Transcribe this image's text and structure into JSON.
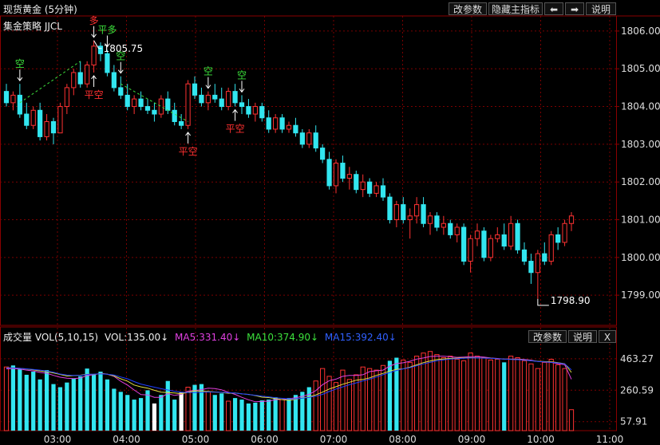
{
  "header": {
    "title": "现货黄金 (5分钟)",
    "strategy": "集金策略 JJCL",
    "buttons": {
      "params": "改参数",
      "hide_indicator": "隐藏主指标",
      "left": "⬅",
      "right": "➡",
      "help": "说明"
    }
  },
  "volume_header": {
    "title": "成交量 VOL(5,10,15)",
    "vol": "VOL:135.00↓",
    "ma5": "MA5:331.40↓",
    "ma10": "MA10:374.90↓",
    "ma15": "MA15:392.40↓",
    "buttons": {
      "params": "改参数",
      "help": "说明",
      "close": "X"
    }
  },
  "colors": {
    "up": "#ff3232",
    "down": "#32e6f0",
    "ma5": "#e040e0",
    "ma10": "#e0e040",
    "ma15": "#2040ff",
    "grid": "#7a0000",
    "axis_text": "#ddd",
    "signal_green": "#3ce03c",
    "signal_red": "#ff3030"
  },
  "chart_data": [
    {
      "type": "candlestick",
      "x_ticks": [
        "03:00",
        "04:00",
        "05:00",
        "06:00",
        "07:00",
        "08:00",
        "09:00",
        "10:00",
        "11:00"
      ],
      "y_ticks": [
        1799,
        1800,
        1801,
        1802,
        1803,
        1804,
        1805,
        1806
      ],
      "y_tick_labels": [
        "1799.00",
        "1800.00",
        "1801.00",
        "1802.00",
        "1803.00",
        "1804.00",
        "1805.00",
        "1806.00"
      ],
      "ylim": [
        1798.2,
        1806.4
      ],
      "annotations": {
        "high": "1805.75",
        "low": "1798.90"
      },
      "signals": [
        {
          "label": "空",
          "arrow": "down",
          "bar": 2
        },
        {
          "label": "多",
          "arrow": "down",
          "bar": 13
        },
        {
          "label": "平多",
          "arrow": "down",
          "bar": 15
        },
        {
          "label": "平空",
          "arrow": "up",
          "bar": 13
        },
        {
          "label": "空",
          "arrow": "down",
          "bar": 17
        },
        {
          "label": "平空",
          "arrow": "up",
          "bar": 27
        },
        {
          "label": "空",
          "arrow": "down",
          "bar": 30
        },
        {
          "label": "空",
          "arrow": "down",
          "bar": 35
        },
        {
          "label": "平空",
          "arrow": "up",
          "bar": 34
        }
      ],
      "ohlc": [
        [
          1804.4,
          1804.6,
          1804.0,
          1804.1
        ],
        [
          1804.1,
          1804.4,
          1803.9,
          1804.3
        ],
        [
          1804.3,
          1804.6,
          1803.7,
          1803.8
        ],
        [
          1803.8,
          1804.1,
          1803.4,
          1803.5
        ],
        [
          1803.5,
          1804.0,
          1803.4,
          1803.9
        ],
        [
          1803.9,
          1804.1,
          1803.1,
          1803.2
        ],
        [
          1803.2,
          1803.8,
          1803.1,
          1803.6
        ],
        [
          1803.6,
          1803.7,
          1803.0,
          1803.3
        ],
        [
          1803.3,
          1804.1,
          1803.3,
          1804.0
        ],
        [
          1804.0,
          1804.6,
          1803.8,
          1804.5
        ],
        [
          1804.5,
          1805.0,
          1804.3,
          1804.9
        ],
        [
          1804.9,
          1805.2,
          1804.5,
          1804.6
        ],
        [
          1804.6,
          1805.2,
          1804.5,
          1805.1
        ],
        [
          1805.1,
          1805.75,
          1804.9,
          1805.6
        ],
        [
          1805.6,
          1805.7,
          1805.2,
          1805.4
        ],
        [
          1805.4,
          1805.5,
          1804.8,
          1804.9
        ],
        [
          1804.9,
          1805.1,
          1804.4,
          1804.5
        ],
        [
          1804.5,
          1804.8,
          1804.2,
          1804.3
        ],
        [
          1804.3,
          1804.6,
          1803.9,
          1804.0
        ],
        [
          1804.0,
          1804.3,
          1803.8,
          1804.2
        ],
        [
          1804.2,
          1804.4,
          1803.9,
          1804.0
        ],
        [
          1804.0,
          1804.2,
          1803.8,
          1803.9
        ],
        [
          1803.9,
          1804.1,
          1803.6,
          1803.8
        ],
        [
          1803.8,
          1804.3,
          1803.7,
          1804.2
        ],
        [
          1804.2,
          1804.4,
          1803.8,
          1803.9
        ],
        [
          1803.9,
          1804.1,
          1803.5,
          1803.6
        ],
        [
          1803.6,
          1803.8,
          1803.4,
          1803.5
        ],
        [
          1803.5,
          1804.7,
          1803.4,
          1804.6
        ],
        [
          1804.6,
          1804.8,
          1804.2,
          1804.3
        ],
        [
          1804.3,
          1804.5,
          1804.0,
          1804.1
        ],
        [
          1804.1,
          1804.4,
          1803.9,
          1804.3
        ],
        [
          1804.3,
          1804.6,
          1804.1,
          1804.2
        ],
        [
          1804.2,
          1804.5,
          1803.9,
          1804.0
        ],
        [
          1804.0,
          1804.5,
          1803.9,
          1804.4
        ],
        [
          1804.4,
          1804.6,
          1804.0,
          1804.1
        ],
        [
          1804.1,
          1804.3,
          1803.8,
          1804.0
        ],
        [
          1804.0,
          1804.2,
          1803.7,
          1803.8
        ],
        [
          1803.8,
          1804.1,
          1803.6,
          1804.0
        ],
        [
          1804.0,
          1804.1,
          1803.6,
          1803.7
        ],
        [
          1803.7,
          1803.9,
          1803.3,
          1803.4
        ],
        [
          1803.4,
          1803.8,
          1803.3,
          1803.7
        ],
        [
          1803.7,
          1803.8,
          1803.3,
          1803.4
        ],
        [
          1803.4,
          1803.6,
          1803.3,
          1803.5
        ],
        [
          1803.5,
          1803.7,
          1803.2,
          1803.3
        ],
        [
          1803.3,
          1803.4,
          1802.9,
          1803.0
        ],
        [
          1803.0,
          1803.4,
          1802.9,
          1803.3
        ],
        [
          1803.3,
          1803.5,
          1802.8,
          1802.9
        ],
        [
          1802.9,
          1803.0,
          1802.5,
          1802.6
        ],
        [
          1802.6,
          1802.8,
          1801.8,
          1801.9
        ],
        [
          1801.9,
          1802.6,
          1801.7,
          1802.5
        ],
        [
          1802.5,
          1802.7,
          1802.0,
          1802.1
        ],
        [
          1802.1,
          1802.4,
          1801.8,
          1802.2
        ],
        [
          1802.2,
          1802.3,
          1801.7,
          1801.8
        ],
        [
          1801.8,
          1802.2,
          1801.6,
          1802.0
        ],
        [
          1802.0,
          1802.1,
          1801.6,
          1801.7
        ],
        [
          1801.7,
          1802.0,
          1801.6,
          1801.9
        ],
        [
          1801.9,
          1802.1,
          1801.5,
          1801.6
        ],
        [
          1801.6,
          1801.7,
          1800.9,
          1801.0
        ],
        [
          1801.0,
          1801.5,
          1800.8,
          1801.4
        ],
        [
          1801.4,
          1801.6,
          1800.9,
          1801.0
        ],
        [
          1801.0,
          1801.3,
          1800.5,
          1801.1
        ],
        [
          1801.1,
          1801.6,
          1800.9,
          1801.4
        ],
        [
          1801.4,
          1801.6,
          1800.8,
          1800.9
        ],
        [
          1800.9,
          1801.2,
          1800.6,
          1801.1
        ],
        [
          1801.1,
          1801.2,
          1800.7,
          1800.8
        ],
        [
          1800.8,
          1801.1,
          1800.6,
          1800.9
        ],
        [
          1800.9,
          1801.0,
          1800.5,
          1800.6
        ],
        [
          1800.6,
          1800.9,
          1800.4,
          1800.8
        ],
        [
          1800.8,
          1800.9,
          1799.8,
          1799.9
        ],
        [
          1799.9,
          1800.6,
          1799.6,
          1800.5
        ],
        [
          1800.5,
          1800.9,
          1800.3,
          1800.7
        ],
        [
          1800.7,
          1800.8,
          1799.9,
          1800.0
        ],
        [
          1800.0,
          1800.6,
          1799.9,
          1800.5
        ],
        [
          1800.5,
          1800.8,
          1800.4,
          1800.6
        ],
        [
          1800.6,
          1800.9,
          1800.2,
          1800.3
        ],
        [
          1800.3,
          1801.1,
          1800.2,
          1800.9
        ],
        [
          1800.9,
          1801.0,
          1800.1,
          1800.2
        ],
        [
          1800.2,
          1800.4,
          1799.8,
          1799.9
        ],
        [
          1799.9,
          1800.1,
          1799.3,
          1799.6
        ],
        [
          1799.6,
          1800.2,
          1798.9,
          1800.1
        ],
        [
          1800.1,
          1800.4,
          1799.8,
          1799.9
        ],
        [
          1799.9,
          1800.7,
          1799.8,
          1800.6
        ],
        [
          1800.6,
          1800.8,
          1800.2,
          1800.4
        ],
        [
          1800.4,
          1801.0,
          1800.3,
          1800.9
        ],
        [
          1800.9,
          1801.2,
          1800.7,
          1801.1
        ]
      ]
    },
    {
      "type": "bar",
      "name": "VOL",
      "y_tick_labels": [
        "463.27",
        "260.59",
        "57.91"
      ],
      "y_ticks": [
        463.27,
        260.59,
        57.91
      ],
      "ylim": [
        0,
        560
      ],
      "values": [
        410,
        420,
        395,
        360,
        380,
        330,
        390,
        300,
        280,
        310,
        335,
        350,
        400,
        360,
        380,
        330,
        270,
        250,
        230,
        200,
        210,
        260,
        175,
        230,
        320,
        200,
        245,
        280,
        295,
        300,
        250,
        230,
        240,
        190,
        210,
        200,
        175,
        180,
        195,
        200,
        215,
        200,
        210,
        230,
        250,
        280,
        320,
        400,
        350,
        310,
        390,
        330,
        360,
        410,
        400,
        390,
        420,
        450,
        470,
        455,
        440,
        480,
        500,
        510,
        490,
        470,
        480,
        460,
        450,
        500,
        480,
        470,
        455,
        460,
        440,
        480,
        470,
        450,
        430,
        400,
        440,
        460,
        425,
        400,
        135
      ],
      "bar_colors": [
        "up",
        "down",
        "down",
        "down",
        "down",
        "down",
        "down",
        "down",
        "down",
        "down",
        "down",
        "down",
        "down",
        "down",
        "down",
        "down",
        "down",
        "down",
        "down",
        "down",
        "down",
        "down",
        "white",
        "down",
        "down",
        "down",
        "white",
        "up",
        "down",
        "down",
        "up",
        "down",
        "down",
        "up",
        "down",
        "down",
        "down",
        "down",
        "down",
        "down",
        "down",
        "up",
        "down",
        "down",
        "down",
        "down",
        "up",
        "up",
        "up",
        "up",
        "up",
        "up",
        "up",
        "up",
        "up",
        "up",
        "up",
        "down",
        "down",
        "up",
        "up",
        "up",
        "up",
        "up",
        "up",
        "up",
        "up",
        "up",
        "up",
        "up",
        "up",
        "up",
        "up",
        "up",
        "down",
        "up",
        "up",
        "up",
        "up",
        "up",
        "up",
        "up",
        "up",
        "up",
        "up"
      ],
      "ma5": [
        398,
        400,
        397,
        390,
        385,
        375,
        370,
        356,
        344,
        338,
        335,
        339,
        355,
        360,
        369,
        364,
        350,
        318,
        294,
        262,
        232,
        230,
        215,
        215,
        239,
        227,
        234,
        255,
        258,
        264,
        274,
        271,
        263,
        247,
        234,
        215,
        199,
        186,
        188,
        190,
        200,
        201,
        205,
        212,
        221,
        234,
        258,
        296,
        322,
        332,
        350,
        356,
        356,
        360,
        380,
        386,
        390,
        416,
        432,
        437,
        447,
        461,
        468,
        478,
        480,
        480,
        476,
        472,
        474,
        477,
        477,
        474,
        468,
        465,
        461,
        461,
        461,
        459,
        454,
        446,
        442,
        440,
        431,
        425,
        331
      ],
      "ma10": [
        405,
        405,
        401,
        397,
        392,
        385,
        380,
        372,
        362,
        352,
        355,
        357,
        364,
        362,
        368,
        363,
        353,
        334,
        319,
        294,
        282,
        274,
        260,
        248,
        245,
        243,
        238,
        247,
        257,
        254,
        252,
        249,
        246,
        241,
        243,
        237,
        234,
        226,
        216,
        213,
        207,
        200,
        196,
        202,
        211,
        218,
        230,
        248,
        268,
        283,
        299,
        312,
        325,
        330,
        340,
        356,
        369,
        384,
        395,
        398,
        409,
        424,
        438,
        449,
        458,
        462,
        465,
        467,
        469,
        470,
        469,
        468,
        467,
        463,
        461,
        460,
        459,
        455,
        451,
        447,
        445,
        444,
        438,
        431,
        375
      ],
      "ma15": [
        405,
        405,
        401,
        398,
        394,
        390,
        384,
        376,
        365,
        358,
        356,
        356,
        362,
        364,
        366,
        363,
        358,
        346,
        334,
        316,
        300,
        290,
        280,
        270,
        262,
        254,
        248,
        245,
        245,
        247,
        249,
        248,
        247,
        244,
        242,
        238,
        232,
        228,
        222,
        218,
        212,
        208,
        204,
        205,
        209,
        214,
        222,
        234,
        252,
        268,
        282,
        296,
        308,
        320,
        332,
        346,
        360,
        374,
        388,
        398,
        406,
        418,
        430,
        440,
        450,
        456,
        461,
        464,
        466,
        468,
        468,
        467,
        466,
        463,
        461,
        459,
        457,
        454,
        450,
        446,
        443,
        441,
        436,
        430,
        392
      ]
    }
  ]
}
